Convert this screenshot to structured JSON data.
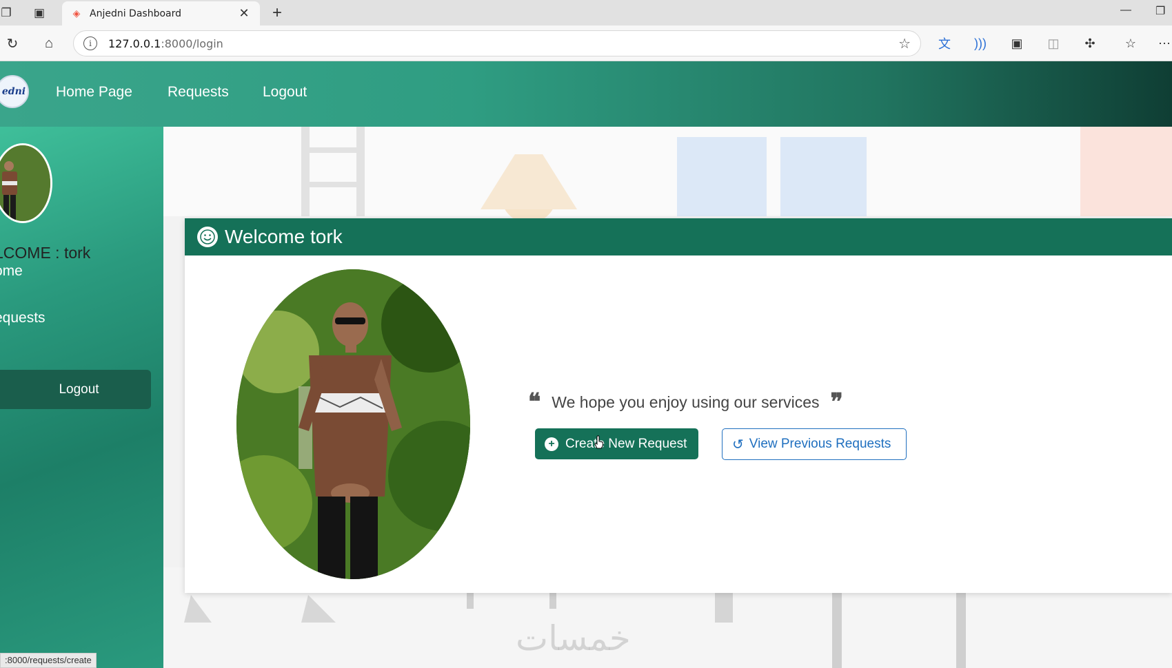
{
  "browser": {
    "tab_title": "Anjedni Dashboard",
    "new_tab_symbol": "+",
    "url_host": "127.0.0.1",
    "url_path": ":8000/login"
  },
  "logo": {
    "text": "edni"
  },
  "header_nav": {
    "home": "Home Page",
    "requests": "Requests",
    "logout": "Logout"
  },
  "sidebar": {
    "welcome": "LCOME : tork",
    "home": "ome",
    "requests": "equests",
    "logout": "Logout"
  },
  "card": {
    "title": "Welcome tork",
    "quote": "We hope you enjoy using our services",
    "open_quote": "❝",
    "close_quote": "❞",
    "create_button": "Create New Request",
    "view_button": "View Previous Requests"
  },
  "status_bar": {
    "url": ":8000/requests/create"
  },
  "watermark": "خمسات",
  "colors": {
    "primary": "#157158",
    "outline": "#1f6fbf",
    "sidebar": "#2a9a7e"
  }
}
